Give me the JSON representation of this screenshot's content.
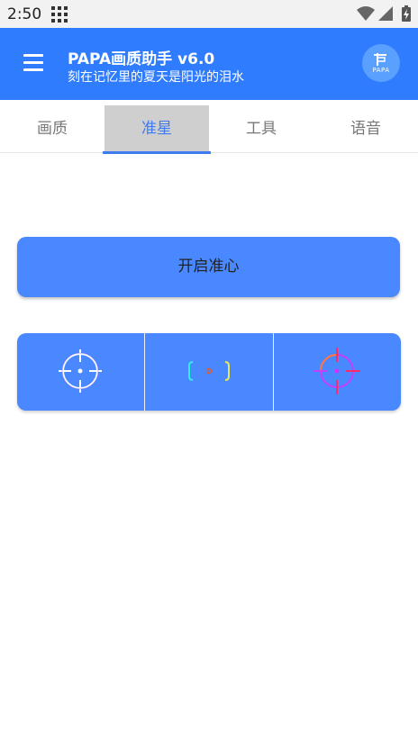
{
  "status_bar": {
    "time": "2:50",
    "icons": [
      "grid-icon",
      "wifi-icon",
      "signal-icon",
      "battery-icon"
    ]
  },
  "app_bar": {
    "title": "PAPA画质助手 v6.0",
    "subtitle": "刻在记忆里的夏天是阳光的泪水",
    "avatar_text": "PAPA",
    "background": "#2f7cff"
  },
  "tabs": [
    {
      "label": "画质",
      "selected": false
    },
    {
      "label": "准星",
      "selected": true
    },
    {
      "label": "工具",
      "selected": false
    },
    {
      "label": "语音",
      "selected": false
    }
  ],
  "main": {
    "enable_button": "开启准心",
    "crosshair_styles": [
      "white-crosshair-icon",
      "bracket-dot-icon",
      "gradient-crosshair-icon"
    ]
  },
  "colors": {
    "accent": "#3f7bf0",
    "button_bg": "#4a88ff"
  }
}
